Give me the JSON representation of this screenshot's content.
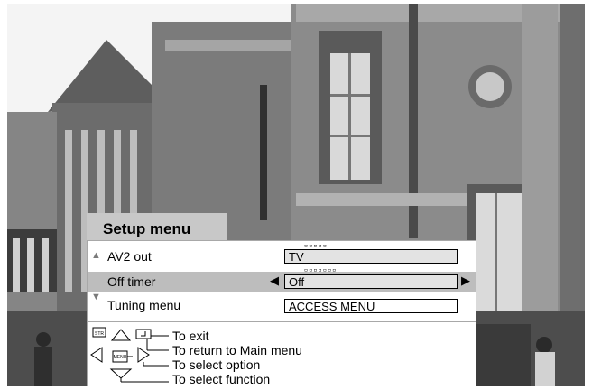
{
  "menu": {
    "title": "Setup menu",
    "items": [
      {
        "label": "AV2 out",
        "value": "TV",
        "bits": "▫▫▫▫▫"
      },
      {
        "label": "Off timer",
        "value": "Off",
        "bits": "▫▫▫▫▫▫▫",
        "selected": true
      },
      {
        "label": "Tuning menu",
        "value": "ACCESS MENU"
      }
    ],
    "up_arrow": "▲",
    "down_arrow": "▼",
    "left_arrow": "◀",
    "right_arrow": "▶"
  },
  "legend": {
    "exit": "To exit",
    "main_menu": "To return to Main menu",
    "select_option": "To select option",
    "select_function": "To select function",
    "str_key": "STR",
    "menu_key": "MENU"
  },
  "colors": {
    "highlight": "#bdbdbd",
    "panel": "#ffffff",
    "title_tab": "#c8c8c8",
    "value_box": "#e3e3e3"
  }
}
